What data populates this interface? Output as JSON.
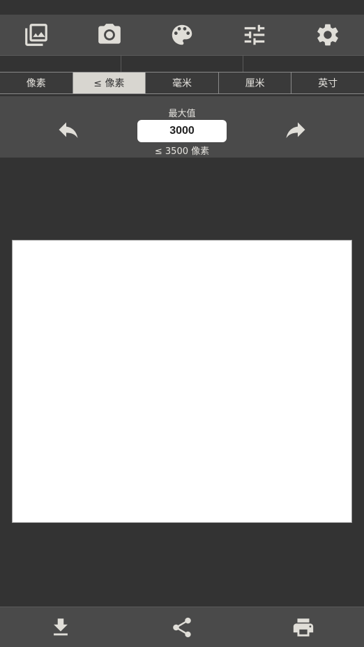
{
  "toolbar": {
    "icons": [
      "photo-library-icon",
      "camera-icon",
      "palette-icon",
      "tune-icon",
      "settings-icon"
    ]
  },
  "unit_tabs": {
    "items": [
      {
        "label": "像素"
      },
      {
        "label": "≤ 像素"
      },
      {
        "label": "毫米"
      },
      {
        "label": "厘米"
      },
      {
        "label": "英寸"
      }
    ],
    "active_index": 1
  },
  "size_panel": {
    "max_label": "最大值",
    "max_value": "3000",
    "limit_note": "≤ 3500 像素"
  },
  "bottom_toolbar": {
    "icons": [
      "download-icon",
      "share-icon",
      "print-icon"
    ]
  },
  "colors": {
    "background": "#333333",
    "toolbar": "#4a4a4a",
    "active_tab": "#d8d6d0",
    "icon": "#e0ded8"
  }
}
